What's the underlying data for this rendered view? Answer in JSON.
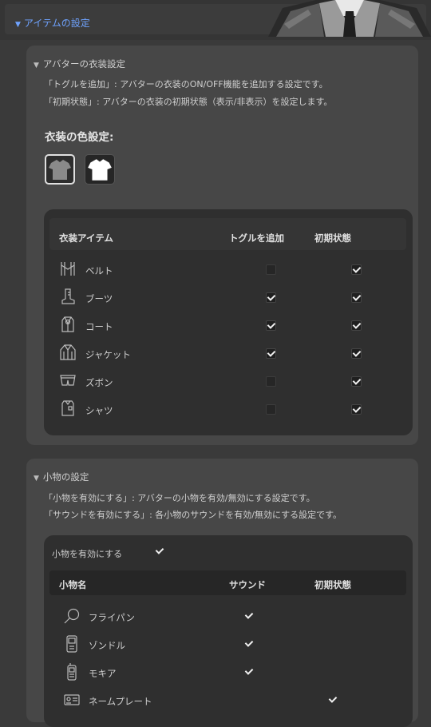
{
  "header": {
    "title": "アイテムの設定"
  },
  "outfit": {
    "title": "アバターの衣装設定",
    "desc1": "「トグルを追加」: アバターの衣装のON/OFF機能を追加する設定です。",
    "desc2": "「初期状態」: アバターの衣装の初期状態（表示/非表示）を設定します。",
    "color_title": "衣装の色設定:",
    "swatches": [
      {
        "name": "gray-shirt-icon",
        "color": "#8a8a8a"
      },
      {
        "name": "white-shirt-icon",
        "color": "#ffffff"
      }
    ],
    "table": {
      "col_item": "衣装アイテム",
      "col_toggle": "トグルを追加",
      "col_initial": "初期状態",
      "rows": [
        {
          "label": "ベルト",
          "icon": "belt-icon",
          "toggle": false,
          "initial": true
        },
        {
          "label": "ブーツ",
          "icon": "boots-icon",
          "toggle": true,
          "initial": true
        },
        {
          "label": "コート",
          "icon": "coat-icon",
          "toggle": true,
          "initial": true
        },
        {
          "label": "ジャケット",
          "icon": "jacket-icon",
          "toggle": true,
          "initial": true
        },
        {
          "label": "ズボン",
          "icon": "pants-icon",
          "toggle": false,
          "initial": true
        },
        {
          "label": "シャツ",
          "icon": "shirt-icon",
          "toggle": false,
          "initial": true
        }
      ]
    }
  },
  "props": {
    "title": "小物の設定",
    "desc1": "「小物を有効にする」: アバターの小物を有効/無効にする設定です。",
    "desc2": "「サウンドを有効にする」: 各小物のサウンドを有効/無効にする設定です。",
    "enable_label": "小物を有効にする",
    "enable_checked": true,
    "table": {
      "col_name": "小物名",
      "col_sound": "サウンド",
      "col_initial": "初期状態",
      "rows": [
        {
          "label": "フライパン",
          "icon": "frying-pan-icon",
          "sound": true,
          "initial": false
        },
        {
          "label": "ゾンドル",
          "icon": "phone-icon",
          "sound": true,
          "initial": false
        },
        {
          "label": "モキア",
          "icon": "cellphone-icon",
          "sound": true,
          "initial": false
        },
        {
          "label": "ネームプレート",
          "icon": "name-plate-icon",
          "sound": false,
          "initial": true
        }
      ]
    }
  }
}
